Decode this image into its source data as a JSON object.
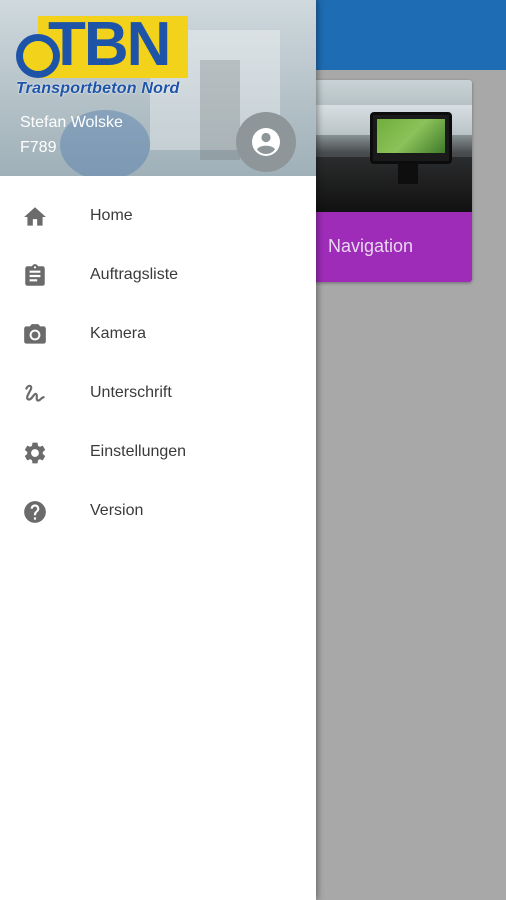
{
  "background": {
    "card": {
      "label": "Navigation"
    }
  },
  "drawer": {
    "logo": {
      "main": "TBN",
      "sub": "Transportbeton Nord"
    },
    "user": {
      "name": "Stefan Wolske",
      "id": "F789"
    },
    "items": [
      {
        "label": "Home",
        "icon": "home-icon"
      },
      {
        "label": "Auftragsliste",
        "icon": "clipboard-icon"
      },
      {
        "label": "Kamera",
        "icon": "camera-icon"
      },
      {
        "label": "Unterschrift",
        "icon": "signature-icon"
      },
      {
        "label": "Einstellungen",
        "icon": "gear-icon"
      },
      {
        "label": "Version",
        "icon": "help-icon"
      }
    ]
  },
  "colors": {
    "app_bar": "#1e6cb4",
    "card_accent": "#9e2cb8",
    "logo_yellow": "#f3d21b",
    "logo_blue": "#1e54a8",
    "icon_gray": "#6b6b6b"
  }
}
